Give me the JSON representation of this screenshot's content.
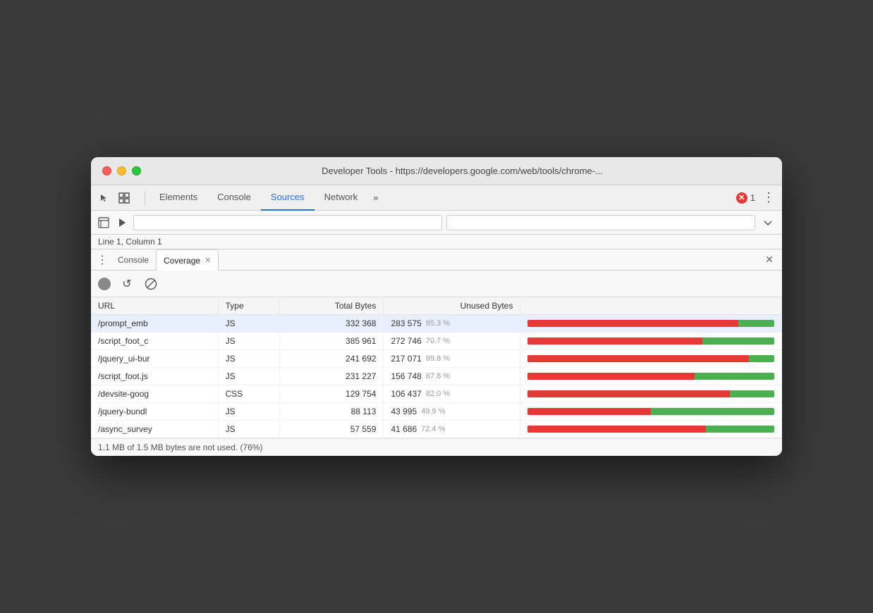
{
  "window": {
    "title": "Developer Tools - https://developers.google.com/web/tools/chrome-..."
  },
  "tabs": {
    "items": [
      {
        "id": "elements",
        "label": "Elements",
        "active": false
      },
      {
        "id": "console",
        "label": "Console",
        "active": false
      },
      {
        "id": "sources",
        "label": "Sources",
        "active": true
      },
      {
        "id": "network",
        "label": "Network",
        "active": false
      },
      {
        "id": "more",
        "label": "»",
        "active": false
      }
    ]
  },
  "error_badge": {
    "count": "1"
  },
  "secondary_toolbar": {
    "placeholder": ""
  },
  "status_bar": {
    "text": "Line 1, Column 1"
  },
  "panel": {
    "tabs": [
      {
        "id": "console",
        "label": "Console",
        "closeable": false,
        "active": false
      },
      {
        "id": "coverage",
        "label": "Coverage",
        "closeable": true,
        "active": true
      }
    ]
  },
  "coverage": {
    "toolbar": {
      "record_label": "●",
      "reload_label": "↺",
      "clear_label": "⊘"
    },
    "table": {
      "headers": [
        "URL",
        "Type",
        "Total Bytes",
        "Unused Bytes",
        ""
      ],
      "rows": [
        {
          "url": "/prompt_emb",
          "type": "JS",
          "total_bytes": "332 368",
          "unused_bytes": "283 575",
          "unused_pct": "85.3 %",
          "used_ratio": 0.147,
          "selected": true
        },
        {
          "url": "/script_foot_c",
          "type": "JS",
          "total_bytes": "385 961",
          "unused_bytes": "272 746",
          "unused_pct": "70.7 %",
          "used_ratio": 0.293,
          "selected": false
        },
        {
          "url": "/jquery_ui-bur",
          "type": "JS",
          "total_bytes": "241 692",
          "unused_bytes": "217 071",
          "unused_pct": "89.8 %",
          "used_ratio": 0.102,
          "selected": false
        },
        {
          "url": "/script_foot.js",
          "type": "JS",
          "total_bytes": "231 227",
          "unused_bytes": "156 748",
          "unused_pct": "67.8 %",
          "used_ratio": 0.322,
          "selected": false
        },
        {
          "url": "/devsite-goog",
          "type": "CSS",
          "total_bytes": "129 754",
          "unused_bytes": "106 437",
          "unused_pct": "82.0 %",
          "used_ratio": 0.18,
          "selected": false
        },
        {
          "url": "/jquery-bundl",
          "type": "JS",
          "total_bytes": "88 113",
          "unused_bytes": "43 995",
          "unused_pct": "49.9 %",
          "used_ratio": 0.501,
          "selected": false
        },
        {
          "url": "/async_survey",
          "type": "JS",
          "total_bytes": "57 559",
          "unused_bytes": "41 686",
          "unused_pct": "72.4 %",
          "used_ratio": 0.276,
          "selected": false
        }
      ]
    },
    "footer": "1.1 MB of 1.5 MB bytes are not used. (76%)"
  }
}
